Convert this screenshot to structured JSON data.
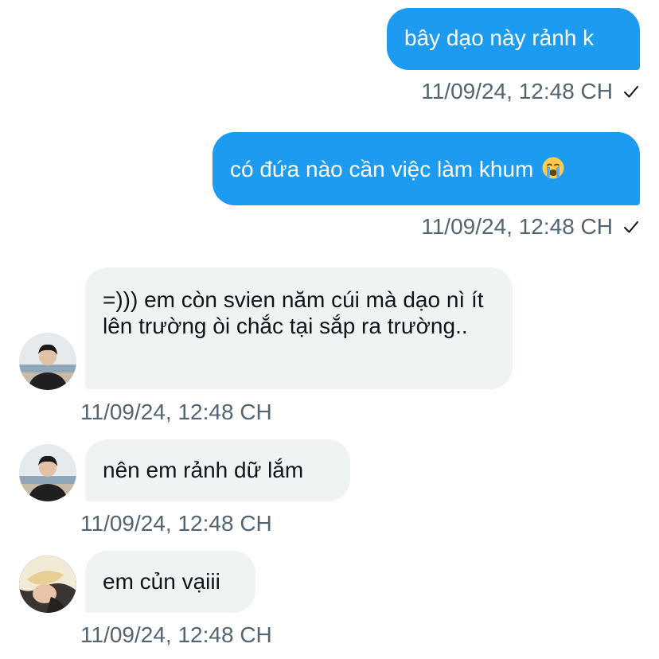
{
  "messages": [
    {
      "direction": "outgoing",
      "text": "bây dạo này rảnh k",
      "timestamp": "11/09/24, 12:48 CH",
      "status_icon": "check-icon"
    },
    {
      "direction": "outgoing",
      "text": "có đứa nào cần việc làm khum",
      "emoji": "loudly-crying-face-icon",
      "timestamp": "11/09/24, 12:48 CH",
      "status_icon": "check-icon"
    },
    {
      "direction": "incoming",
      "sender_avatar": "avatar-person-dark-jacket",
      "text": "=))) em còn svien năm cúi mà dạo nì ít lên trường òi chắc tại sắp ra trường..",
      "timestamp": "11/09/24, 12:48 CH"
    },
    {
      "direction": "incoming",
      "sender_avatar": "avatar-person-dark-jacket",
      "text": "nên em rảnh dữ lắm",
      "timestamp": "11/09/24, 12:48 CH"
    },
    {
      "direction": "incoming",
      "sender_avatar": "avatar-person-blonde-hair",
      "text": "em củn vạiii",
      "timestamp": "11/09/24, 12:48 CH"
    }
  ],
  "colors": {
    "outgoing_bubble": "#1d9bf0",
    "incoming_bubble": "#eff3f4",
    "timestamp_text": "#536471",
    "incoming_text": "#0f1419"
  }
}
